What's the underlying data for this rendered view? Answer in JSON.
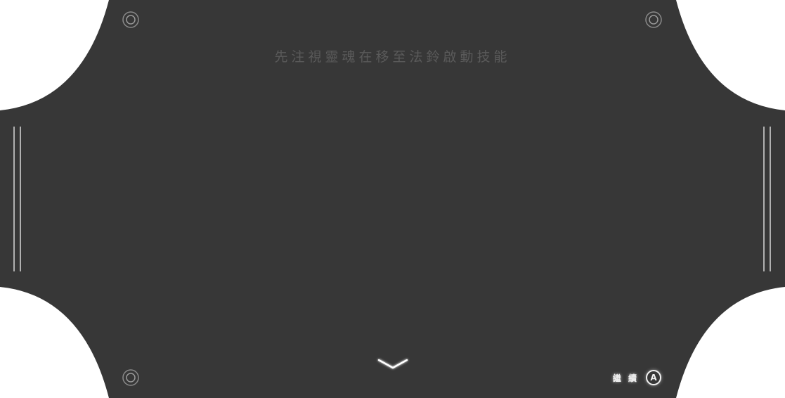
{
  "dialog": {
    "hint": "先注視靈魂在移至法鈴啟動技能",
    "continue_label": "繼 續",
    "button_glyph": "A"
  },
  "icons": {
    "corner": "ring-rivet-icon",
    "next_indicator": "chevron-down-icon",
    "edge_bar": "vertical-line-icon"
  },
  "colors": {
    "panel": "#373737",
    "hint_text": "#5a5a5a",
    "glow": "#ffffff"
  }
}
